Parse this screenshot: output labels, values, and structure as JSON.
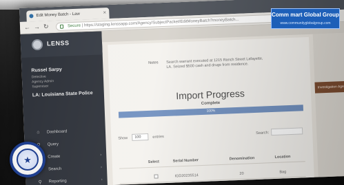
{
  "browser": {
    "tab_title": "Edit Money Batch - Law",
    "url_secure": "Secure",
    "url": "https://staging.lenssapp.com/Agency/SubjectPacket/EditMoneyBatch?moneyBatch..."
  },
  "app": {
    "name": "LENSS",
    "user": {
      "name": "Russel Sarpy",
      "line1": "Detective",
      "line2": "Agency Admin",
      "line3": "Supervisor",
      "org": "LA: Louisiana State Police"
    },
    "nav": [
      {
        "label": "Dashboard",
        "icon": "dashboard-icon"
      },
      {
        "label": "Query",
        "icon": "search-icon"
      },
      {
        "label": "Create",
        "icon": "plus-icon"
      },
      {
        "label": "Search",
        "icon": "search-icon"
      },
      {
        "label": "Reporting",
        "icon": "search-icon"
      }
    ]
  },
  "page": {
    "notes_label": "Notes",
    "notes_text": "Search warrant executed at 1215 Ranch Street Lafayette, LA. Seized $500 cash and drugs from residence.",
    "import_title": "Import Progress",
    "import_status": "Complete",
    "progress_value": 1.0,
    "progress_label": "100%",
    "show_label": "Show",
    "show_value": "100",
    "entries_label": "entries",
    "search_label": "Search:",
    "table_headers": [
      "Select",
      "Serial Number",
      "Denomination",
      "Location"
    ],
    "table_row": {
      "serial": "IGD20235514",
      "denomination": "20",
      "location": "Bag"
    }
  },
  "right_panel": {
    "button_label": "Investigation Agent"
  },
  "watermark": {
    "main": "Comm mart Global Group",
    "url": "www.communityglobalgroup.com"
  },
  "colors": {
    "sidebar": "#2c3038",
    "progress": "#6f8fbf",
    "accent_button": "#7a4a2e",
    "brand_logo": "#1d5fb8"
  }
}
